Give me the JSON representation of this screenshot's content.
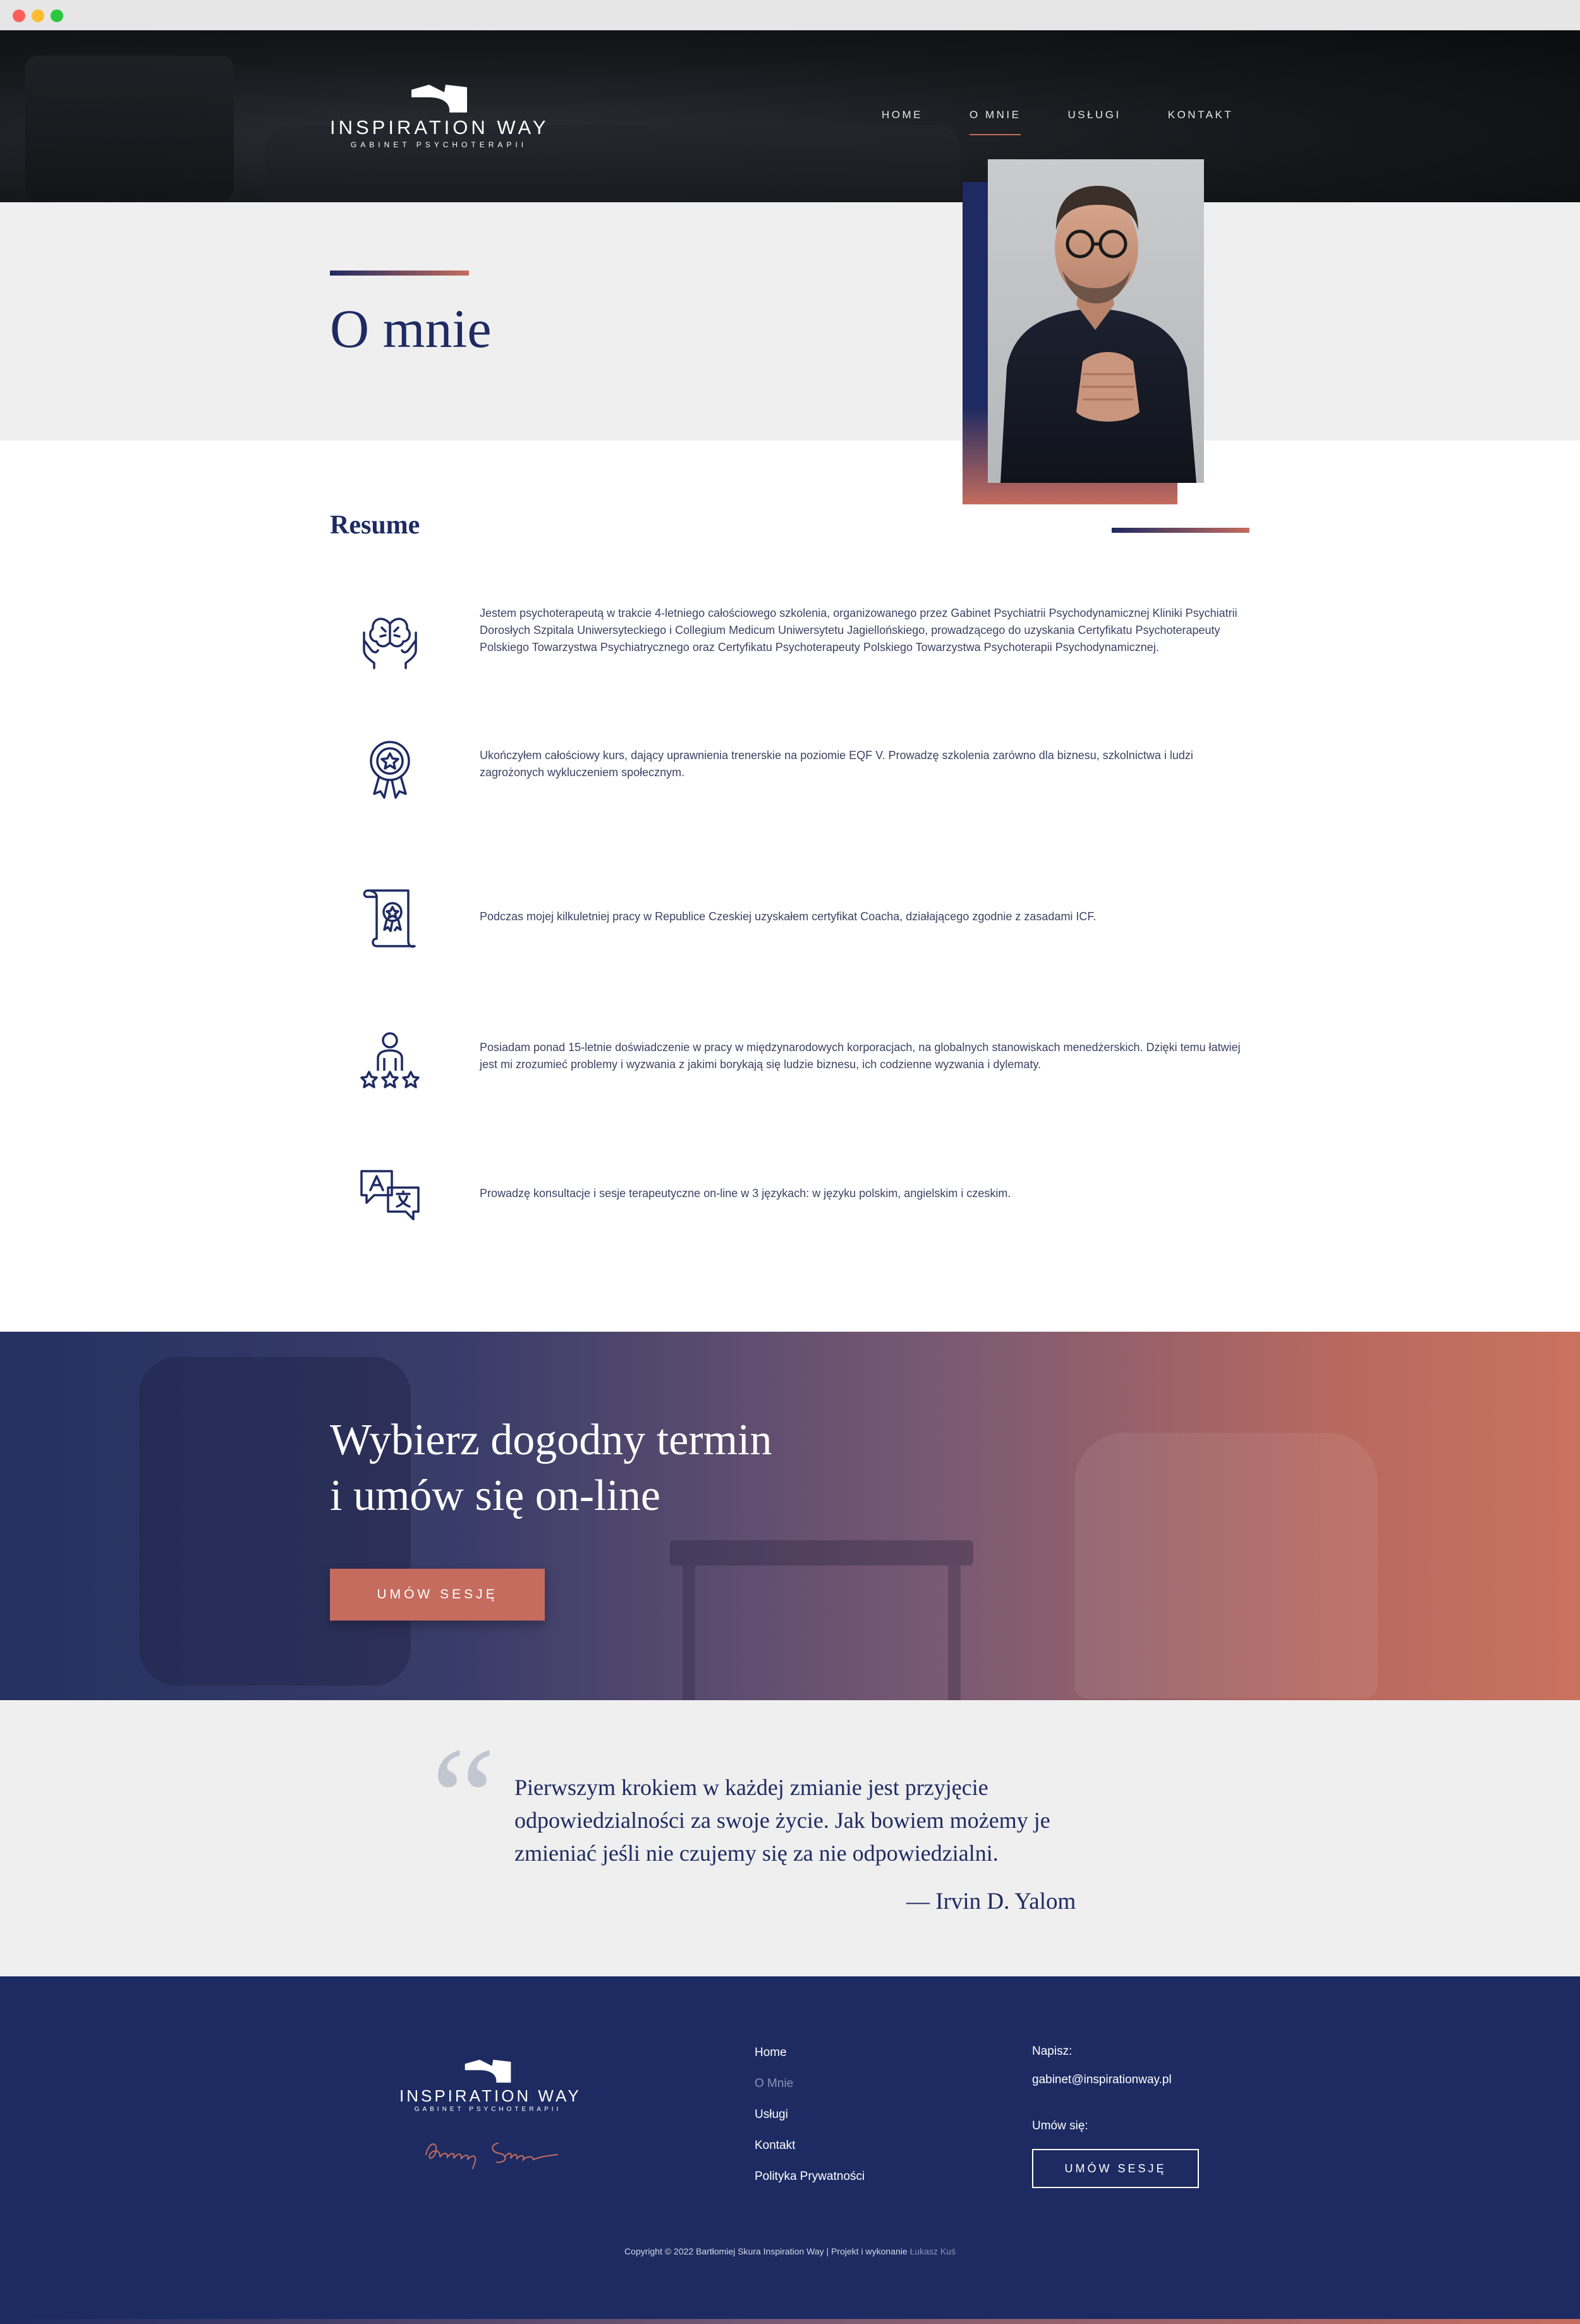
{
  "header": {
    "logo": {
      "name": "INSPIRATION WAY",
      "subtitle": "GABINET PSYCHOTERAPII"
    },
    "nav": [
      {
        "label": "HOME"
      },
      {
        "label": "O MNIE"
      },
      {
        "label": "USŁUGI"
      },
      {
        "label": "KONTAKT"
      }
    ],
    "active_nav": "O MNIE"
  },
  "hero": {
    "title": "O mnie"
  },
  "resume": {
    "title": "Resume",
    "items": [
      {
        "icon": "hands-brain-icon",
        "text": "Jestem psychoterapeutą w trakcie 4-letniego całościowego szkolenia, organizowanego przez Gabinet Psychiatrii Psychodynamicznej Kliniki Psychiatrii Dorosłych Szpitala Uniwersyteckiego i Collegium Medicum Uniwersytetu Jagiellońskiego, prowadzącego do uzyskania Certyfikatu Psychoterapeuty Polskiego Towarzystwa Psychiatrycznego oraz Certyfikatu Psychoterapeuty Polskiego Towarzystwa Psychoterapii Psychodynamicznej."
      },
      {
        "icon": "award-badge-icon",
        "text": "Ukończyłem całościowy kurs, dający uprawnienia trenerskie na poziomie EQF V. Prowadzę szkolenia zarówno dla biznesu, szkolnictwa i ludzi zagrożonych wykluczeniem społecznym."
      },
      {
        "icon": "certificate-scroll-icon",
        "text": "Podczas mojej kilkuletniej pracy w Republice Czeskiej uzyskałem certyfikat Coacha, działającego zgodnie z zasadami ICF."
      },
      {
        "icon": "person-stars-icon",
        "text": "Posiadam ponad 15-letnie doświadczenie w pracy w międzynarodowych korporacjach, na globalnych stanowiskach menedżerskich. Dzięki temu łatwiej jest mi zrozumieć problemy i wyzwania z jakimi borykają się ludzie biznesu, ich codzienne wyzwania i dylematy."
      },
      {
        "icon": "translate-chat-icon",
        "text": "Prowadzę konsultacje i sesje terapeutyczne on-line w 3 językach: w języku polskim, angielskim i czeskim."
      }
    ]
  },
  "cta": {
    "title_line1": "Wybierz dogodny termin",
    "title_line2": "i umów się on-line",
    "button": "UMÓW SESJĘ"
  },
  "quote": {
    "mark": "“",
    "text": "Pierwszym krokiem w każdej zmianie jest przyjęcie odpowiedzialności za swoje życie. Jak bowiem możemy je zmieniać jeśli nie czujemy się za nie odpowiedzialni.",
    "author": "— Irvin D. Yalom"
  },
  "footer": {
    "logo": {
      "name": "INSPIRATION WAY",
      "subtitle": "GABINET PSYCHOTERAPII"
    },
    "menu": [
      {
        "label": "Home"
      },
      {
        "label": "O Mnie"
      },
      {
        "label": "Usługi"
      },
      {
        "label": "Kontakt"
      },
      {
        "label": "Polityka Prywatności"
      }
    ],
    "write_label": "Napisz:",
    "email": "gabinet@inspirationway.pl",
    "book_label": "Umów się:",
    "button": "UMÓW SESJĘ",
    "copyright": "Copyright © 2022 Bartłomiej Skura Inspiration Way | Projekt i wykonanie",
    "author_link": "Łukasz Kuś"
  },
  "colors": {
    "navy": "#1e2a62",
    "terracotta": "#c56c5e",
    "light_bg": "#efefef"
  }
}
